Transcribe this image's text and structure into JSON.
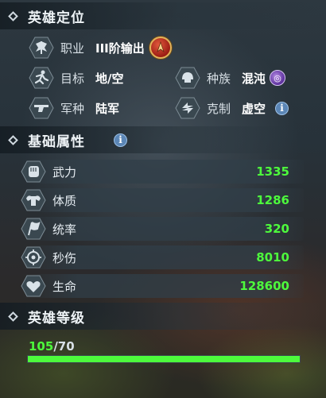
{
  "sections": {
    "positioning": "英雄定位",
    "attributes": "基础属性",
    "level": "英雄等级"
  },
  "info": {
    "job": {
      "label": "职业",
      "value": "III阶输出"
    },
    "target": {
      "label": "目标",
      "value": "地/空"
    },
    "race": {
      "label": "种族",
      "value": "混沌"
    },
    "arm": {
      "label": "军种",
      "value": "陆军"
    },
    "counter": {
      "label": "克制",
      "value": "虚空"
    }
  },
  "stats": [
    {
      "label": "武力",
      "value": "1335",
      "icon": "fist-icon"
    },
    {
      "label": "体质",
      "value": "1286",
      "icon": "muscle-icon"
    },
    {
      "label": "统率",
      "value": "320",
      "icon": "banner-icon"
    },
    {
      "label": "秒伤",
      "value": "8010",
      "icon": "target-icon"
    },
    {
      "label": "生命",
      "value": "128600",
      "icon": "heart-icon"
    }
  ],
  "level": {
    "current": "105",
    "max": "/70",
    "progress": 1.0
  },
  "colors": {
    "stat_green": "#4dfa3c",
    "info_blue": "#5b86b6"
  }
}
